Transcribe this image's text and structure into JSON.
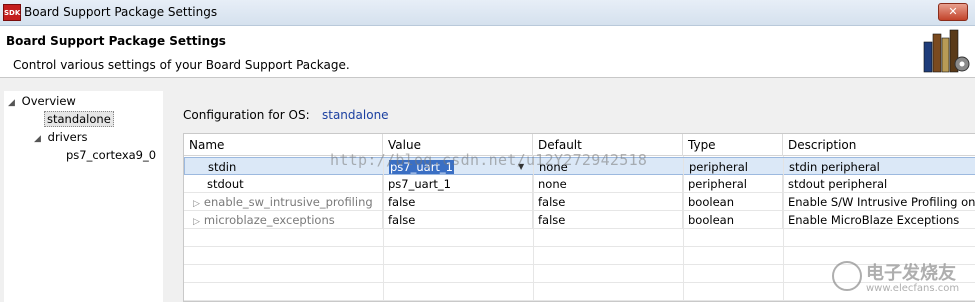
{
  "window": {
    "icon_text": "SDK",
    "title": "Board Support Package Settings",
    "close_label": "✕"
  },
  "header": {
    "title": "Board Support Package Settings",
    "description": "Control various settings of your Board Support Package."
  },
  "tree": {
    "items": [
      {
        "label": "Overview"
      },
      {
        "label": "standalone"
      },
      {
        "label": "drivers"
      },
      {
        "label": "ps7_cortexa9_0"
      }
    ]
  },
  "config": {
    "label": "Configuration for OS:",
    "value": "standalone"
  },
  "table": {
    "columns": [
      "Name",
      "Value",
      "Default",
      "Type",
      "Description"
    ],
    "rows": [
      {
        "name": "stdin",
        "value": "ps7_uart_1",
        "default": "none",
        "type": "peripheral",
        "description": "stdin peripheral"
      },
      {
        "name": "stdout",
        "value": "ps7_uart_1",
        "default": "none",
        "type": "peripheral",
        "description": "stdout peripheral"
      },
      {
        "name": "enable_sw_intrusive_profiling",
        "value": "false",
        "default": "false",
        "type": "boolean",
        "description": "Enable S/W Intrusive Profiling on"
      },
      {
        "name": "microblaze_exceptions",
        "value": "false",
        "default": "false",
        "type": "boolean",
        "description": "Enable MicroBlaze Exceptions"
      }
    ]
  },
  "watermark": {
    "url_text": "http://blog.csdn.net/u12Y272942518",
    "logo_cn": "电子发烧友",
    "logo_url": "www.elecfans.com"
  }
}
